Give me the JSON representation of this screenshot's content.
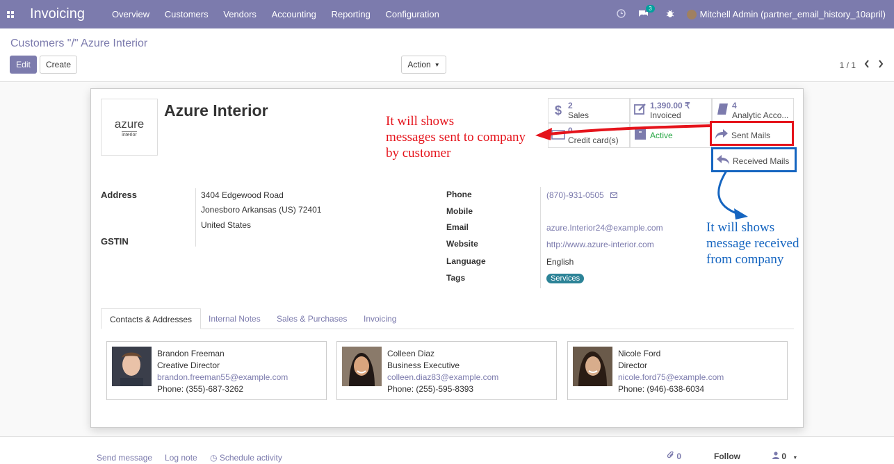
{
  "navbar": {
    "brand": "Invoicing",
    "menu": [
      "Overview",
      "Customers",
      "Vendors",
      "Accounting",
      "Reporting",
      "Configuration"
    ],
    "chat_count": "3",
    "user": "Mitchell Admin (partner_email_history_10april)"
  },
  "control": {
    "breadcrumb": "Customers \"/\" Azure Interior",
    "edit_label": "Edit",
    "create_label": "Create",
    "action_label": "Action",
    "pager": "1 / 1"
  },
  "record": {
    "logo_line1": "azure",
    "logo_line2": "interior",
    "name": "Azure Interior",
    "stats": {
      "sales_num": "2",
      "sales_label": "Sales",
      "invoiced_num": "1,390.00 ₹",
      "invoiced_label": "Invoiced",
      "analytic_num": "4",
      "analytic_label": "Analytic Acco...",
      "credit_num": "0",
      "credit_label": "Credit card(s)",
      "active_label": "Active",
      "sent_label": "Sent Mails",
      "received_label": "Received Mails"
    },
    "labels": {
      "address": "Address",
      "gstin": "GSTIN",
      "phone": "Phone",
      "mobile": "Mobile",
      "email": "Email",
      "website": "Website",
      "language": "Language",
      "tags": "Tags"
    },
    "address_line1": "3404 Edgewood Road",
    "address_line2": "Jonesboro  Arkansas (US)  72401",
    "address_line3": "United States",
    "phone": "(870)-931-0505",
    "email": "azure.Interior24@example.com",
    "website": "http://www.azure-interior.com",
    "language": "English",
    "tag": "Services"
  },
  "tabs": [
    "Contacts & Addresses",
    "Internal Notes",
    "Sales & Purchases",
    "Invoicing"
  ],
  "contacts": [
    {
      "name": "Brandon Freeman",
      "title": "Creative Director",
      "email": "brandon.freeman55@example.com",
      "phone": "Phone: (355)-687-3262"
    },
    {
      "name": "Colleen Diaz",
      "title": "Business Executive",
      "email": "colleen.diaz83@example.com",
      "phone": "Phone: (255)-595-8393"
    },
    {
      "name": "Nicole Ford",
      "title": "Director",
      "email": "nicole.ford75@example.com",
      "phone": "Phone: (946)-638-6034"
    }
  ],
  "chatter": {
    "send_message": "Send message",
    "log_note": "Log note",
    "schedule": "Schedule activity",
    "attachments": "0",
    "follow": "Follow",
    "followers": "0"
  },
  "annotations": {
    "sent_l1": "It will shows",
    "sent_l2": "messages sent to company",
    "sent_l3": "by customer",
    "recv_l1": "It will shows",
    "recv_l2": "message received",
    "recv_l3": "from company",
    "red": "#e5131b",
    "blue": "#1565c0"
  },
  "colors": {
    "primary": "#7c7bad",
    "tag": "#2c8397",
    "active": "#28a745"
  }
}
